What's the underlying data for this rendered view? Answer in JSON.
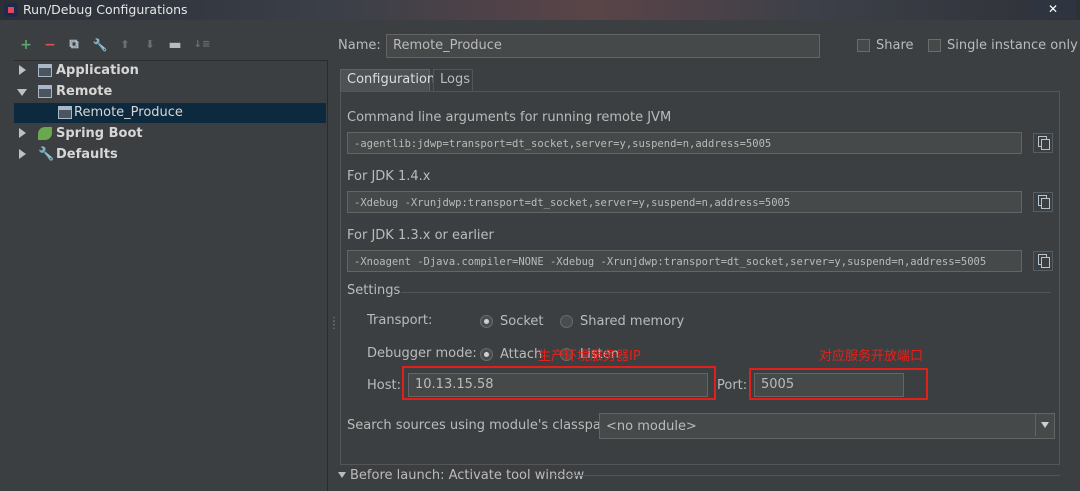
{
  "window": {
    "title": "Run/Debug Configurations",
    "close_glyph": "✕"
  },
  "toolbar": {
    "icons": [
      "add-icon",
      "remove-icon",
      "copy-icon",
      "wrench-icon",
      "move-up-icon",
      "move-down-icon",
      "folder-icon",
      "sort-icon"
    ],
    "add_glyph": "+",
    "remove_glyph": "−",
    "copy_glyph": "⧉",
    "wrench_glyph": "🔧",
    "up_glyph": "⬆",
    "down_glyph": "⬇",
    "folder_glyph": "▬",
    "sort_glyph": "↓≡"
  },
  "tree": {
    "items": [
      {
        "label": "Application",
        "expanded": false,
        "icon": "application-window-icon"
      },
      {
        "label": "Remote",
        "expanded": true,
        "icon": "remote-window-icon"
      },
      {
        "label": "Remote_Produce",
        "selected": true,
        "icon": "remote-config-icon"
      },
      {
        "label": "Spring Boot",
        "expanded": false,
        "icon": "spring-leaf-icon"
      },
      {
        "label": "Defaults",
        "expanded": false,
        "icon": "defaults-wrench-icon"
      }
    ]
  },
  "form": {
    "name_label": "Name:",
    "name_value": "Remote_Produce",
    "share_label": "Share",
    "single_instance_label": "Single instance only",
    "tabs": [
      "Configuration",
      "Logs"
    ],
    "cmd_label": "Command line arguments for running remote JVM",
    "cmd_value": "-agentlib:jdwp=transport=dt_socket,server=y,suspend=n,address=5005",
    "jdk14_label": "For JDK 1.4.x",
    "jdk14_value": "-Xdebug -Xrunjdwp:transport=dt_socket,server=y,suspend=n,address=5005",
    "jdk13_label": "For JDK 1.3.x or earlier",
    "jdk13_value": "-Xnoagent -Djava.compiler=NONE -Xdebug -Xrunjdwp:transport=dt_socket,server=y,suspend=n,address=5005",
    "settings_label": "Settings",
    "transport_label": "Transport:",
    "transport_options": [
      "Socket",
      "Shared memory"
    ],
    "transport_selected": "Socket",
    "debugger_mode_label": "Debugger mode:",
    "debugger_mode_options": [
      "Attach",
      "Listen"
    ],
    "debugger_mode_selected": "Attach",
    "host_label": "Host:",
    "host_value": "10.13.15.58",
    "port_label": "Port:",
    "port_value": "5005",
    "classpath_label": "Search sources using module's classpath:",
    "classpath_value": "<no module>",
    "before_launch_label": "Before launch: Activate tool window"
  },
  "annotations": {
    "host_note": "生产环境服务器IP",
    "port_note": "对应服务开放端口",
    "color": "#e8201a"
  },
  "colors": {
    "background": "#3c3f41",
    "selection": "#0d293e",
    "add_green": "#59a869",
    "remove_red": "#d9534f"
  }
}
